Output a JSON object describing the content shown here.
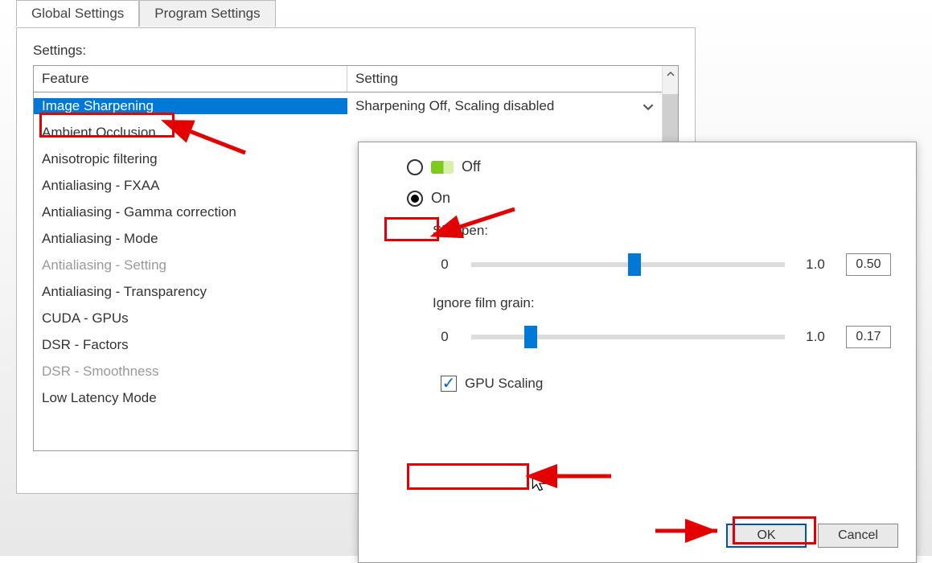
{
  "tabs": {
    "global": "Global Settings",
    "program": "Program Settings"
  },
  "settings_label": "Settings:",
  "columns": {
    "feature": "Feature",
    "setting": "Setting"
  },
  "features": [
    {
      "name": "Image Sharpening",
      "setting": "Sharpening Off, Scaling disabled",
      "selected": true
    },
    {
      "name": "Ambient Occlusion"
    },
    {
      "name": "Anisotropic filtering"
    },
    {
      "name": "Antialiasing - FXAA"
    },
    {
      "name": "Antialiasing - Gamma correction"
    },
    {
      "name": "Antialiasing - Mode"
    },
    {
      "name": "Antialiasing - Setting",
      "disabled": true
    },
    {
      "name": "Antialiasing - Transparency"
    },
    {
      "name": "CUDA - GPUs"
    },
    {
      "name": "DSR - Factors"
    },
    {
      "name": "DSR - Smoothness",
      "disabled": true
    },
    {
      "name": "Low Latency Mode"
    }
  ],
  "popup": {
    "off": "Off",
    "on": "On",
    "sharpen_label": "Sharpen:",
    "grain_label": "Ignore film grain:",
    "min": "0",
    "max": "1.0",
    "sharpen_val": "0.50",
    "grain_val": "0.17",
    "gpu_scaling": "GPU Scaling",
    "ok": "OK",
    "cancel": "Cancel"
  }
}
